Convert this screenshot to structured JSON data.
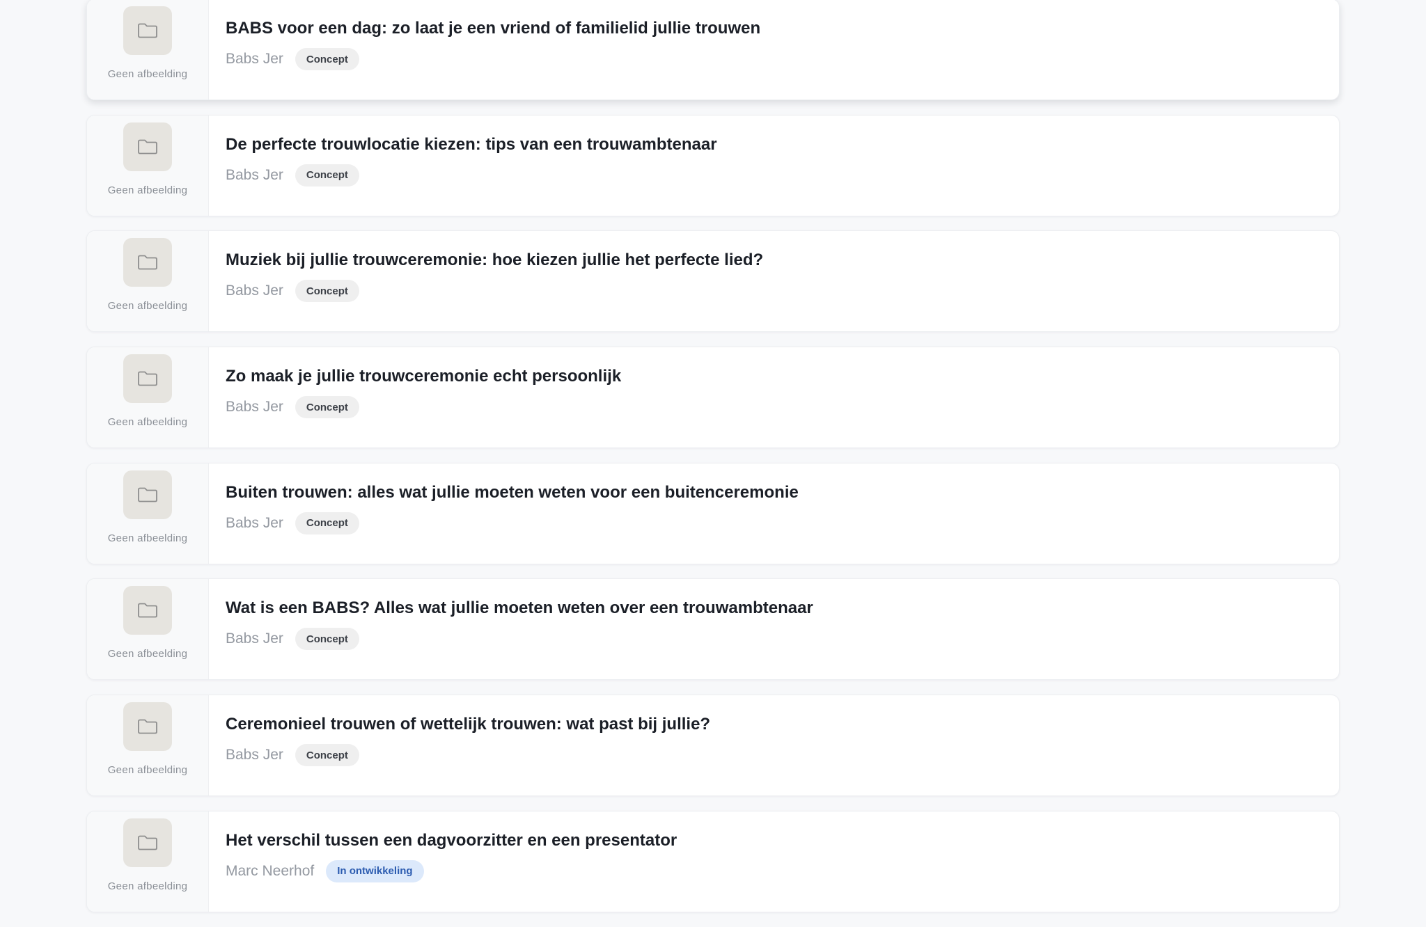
{
  "no_image_label": "Geen afbeelding",
  "colors": {
    "badge_concept_bg": "#efefef",
    "badge_development_bg": "#dce9fb",
    "badge_development_text": "#2c5cb0"
  },
  "articles": [
    {
      "title": "BABS voor een dag: zo laat je een vriend of familielid jullie trouwen",
      "author": "Babs Jer",
      "status": "Concept",
      "status_style": "grey"
    },
    {
      "title": "De perfecte trouwlocatie kiezen: tips van een trouwambtenaar",
      "author": "Babs Jer",
      "status": "Concept",
      "status_style": "grey"
    },
    {
      "title": "Muziek bij jullie trouwceremonie: hoe kiezen jullie het perfecte lied?",
      "author": "Babs Jer",
      "status": "Concept",
      "status_style": "grey"
    },
    {
      "title": "Zo maak je jullie trouwceremonie echt persoonlijk",
      "author": "Babs Jer",
      "status": "Concept",
      "status_style": "grey"
    },
    {
      "title": "Buiten trouwen: alles wat jullie moeten weten voor een buitenceremonie",
      "author": "Babs Jer",
      "status": "Concept",
      "status_style": "grey"
    },
    {
      "title": "Wat is een BABS? Alles wat jullie moeten weten over een trouwambtenaar",
      "author": "Babs Jer",
      "status": "Concept",
      "status_style": "grey"
    },
    {
      "title": "Ceremonieel trouwen of wettelijk trouwen: wat past bij jullie?",
      "author": "Babs Jer",
      "status": "Concept",
      "status_style": "grey"
    },
    {
      "title": "Het verschil tussen een dagvoorzitter en een presentator",
      "author": "Marc Neerhof",
      "status": "In ontwikkeling",
      "status_style": "blue"
    }
  ]
}
